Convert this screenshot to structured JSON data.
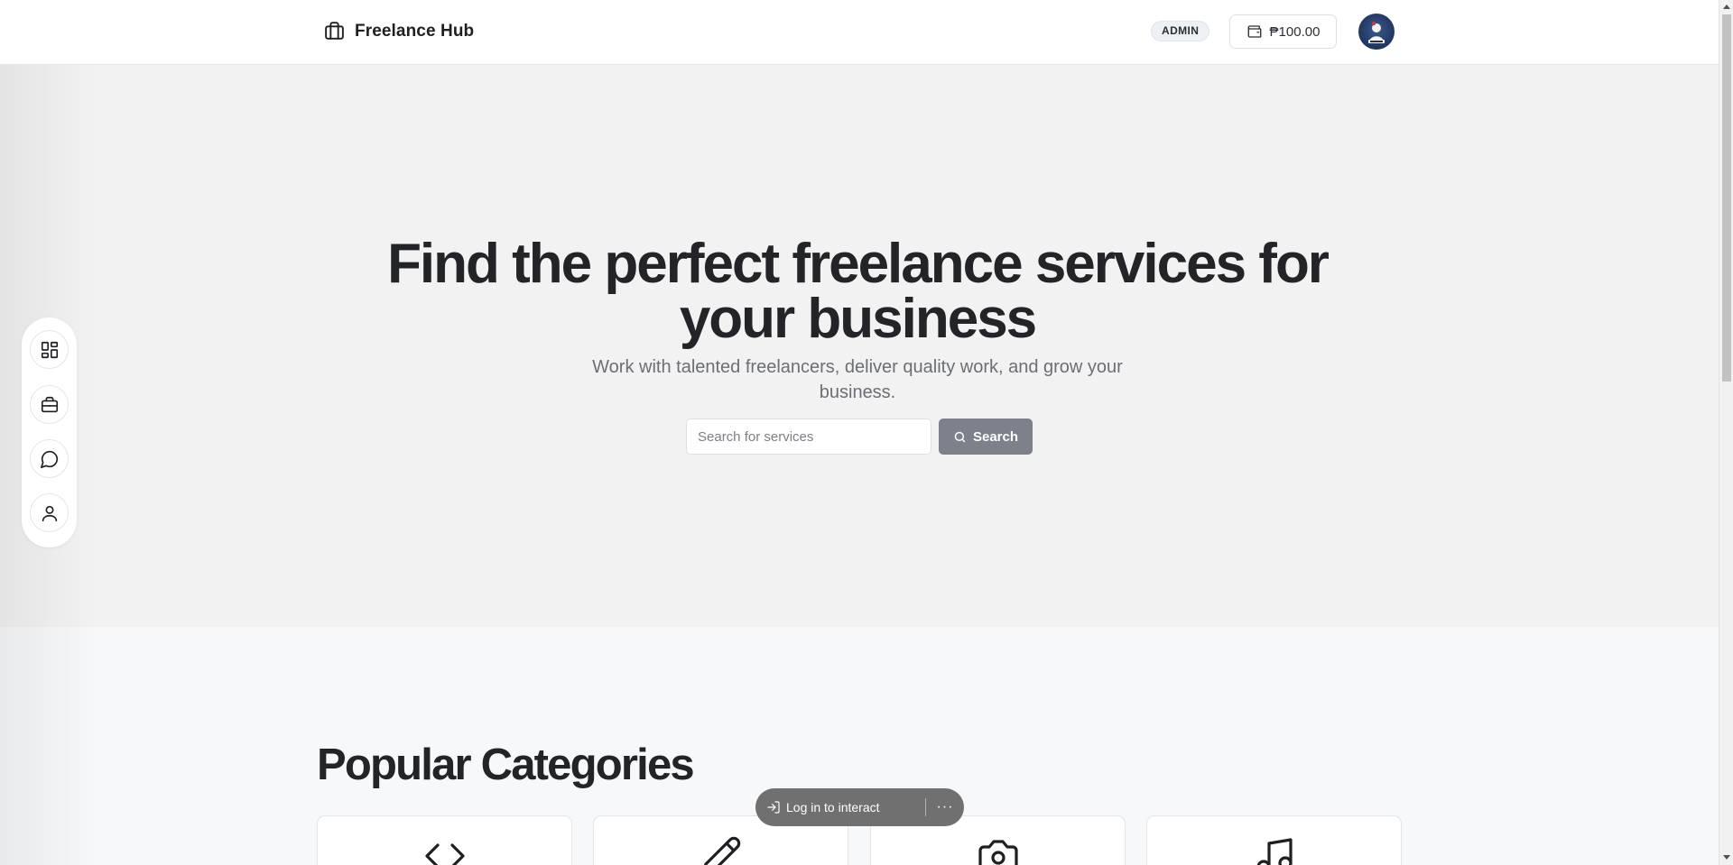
{
  "header": {
    "brand_name": "Freelance Hub",
    "brand_icon": "briefcase-icon",
    "admin_badge": "ADMIN",
    "wallet_balance": "₱100.00",
    "wallet_icon": "wallet-icon",
    "avatar_icon": "avatar-icon"
  },
  "hero": {
    "title": "Find the perfect freelance services for your business",
    "subtitle": "Work with talented freelancers, deliver quality work, and grow your business.",
    "search_placeholder": "Search for services",
    "search_button": "Search",
    "search_icon": "search-icon"
  },
  "side_rail": {
    "items": [
      {
        "name": "dashboard",
        "icon": "dashboard-icon"
      },
      {
        "name": "jobs",
        "icon": "briefcase-icon"
      },
      {
        "name": "messages",
        "icon": "message-icon"
      },
      {
        "name": "profile",
        "icon": "user-icon"
      }
    ]
  },
  "categories": {
    "title": "Popular Categories",
    "items": [
      {
        "icon": "code-icon"
      },
      {
        "icon": "pencil-icon"
      },
      {
        "icon": "camera-icon"
      },
      {
        "icon": "music-icon"
      }
    ]
  },
  "login_prompt": {
    "label": "Log in to interact",
    "more": "···"
  },
  "colors": {
    "hero_bg": "#f2f2f2",
    "search_button_bg": "#7c818c",
    "login_pill_bg": "#707070",
    "avatar_bg": "#1f3461"
  }
}
